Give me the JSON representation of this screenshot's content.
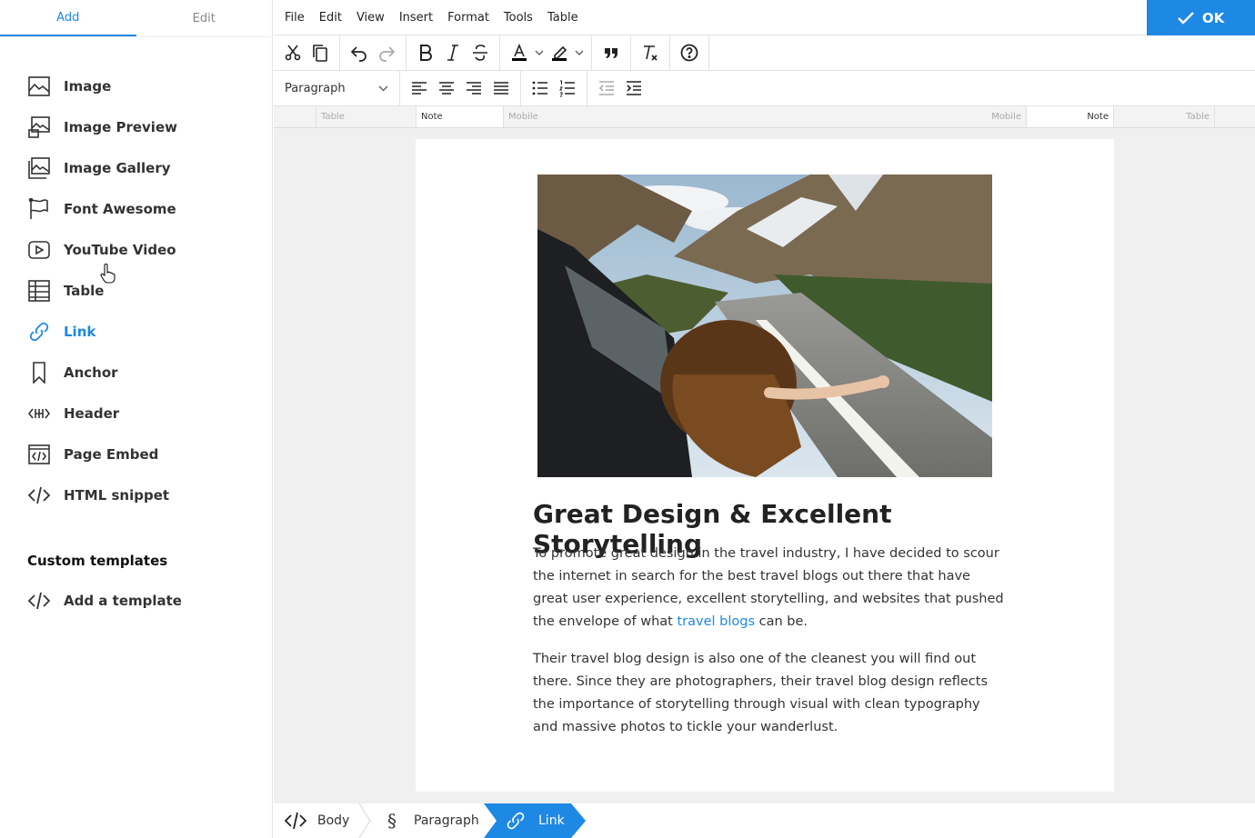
{
  "sidebar": {
    "tabs": [
      "Add",
      "Edit"
    ],
    "blocks": [
      {
        "label": "Image",
        "icon": "image-icon"
      },
      {
        "label": "Image Preview",
        "icon": "image-preview-icon"
      },
      {
        "label": "Image Gallery",
        "icon": "image-gallery-icon"
      },
      {
        "label": "Font Awesome",
        "icon": "flag-icon"
      },
      {
        "label": "YouTube Video",
        "icon": "youtube-icon"
      },
      {
        "label": "Table",
        "icon": "table-icon"
      },
      {
        "label": "Link",
        "icon": "link-icon"
      },
      {
        "label": "Anchor",
        "icon": "bookmark-icon"
      },
      {
        "label": "Header",
        "icon": "header-icon"
      },
      {
        "label": "Page Embed",
        "icon": "page-embed-icon"
      },
      {
        "label": "HTML snippet",
        "icon": "code-icon"
      }
    ],
    "custom_title": "Custom templates",
    "add_template": "Add a template"
  },
  "menubar": {
    "items": [
      "File",
      "Edit",
      "View",
      "Insert",
      "Format",
      "Tools",
      "Table"
    ],
    "ok_label": "OK"
  },
  "toolbar": {
    "paragraph_select": "Paragraph"
  },
  "ruler": {
    "labels": [
      "Table",
      "Note",
      "Mobile",
      "Mobile",
      "Note",
      "Table"
    ]
  },
  "article": {
    "title": "Great Design & Excellent Storytelling",
    "p1_before": "To promote great design in the travel industry, I have decided to scour the internet in search for the best travel blogs out there that have great user experience, excellent storytelling, and websites that pushed the envelope of what ",
    "p1_link": "travel blogs",
    "p1_after": " can be.",
    "p2": "Their travel blog design is also one of the cleanest you will find out there. Since they are photographers, their travel blog design reflects the importance of storytelling through visual with clean typography and massive photos to tickle your wanderlust."
  },
  "breadcrumb": {
    "items": [
      "Body",
      "Paragraph",
      "Link"
    ]
  },
  "colors": {
    "accent": "#1e88e5"
  }
}
